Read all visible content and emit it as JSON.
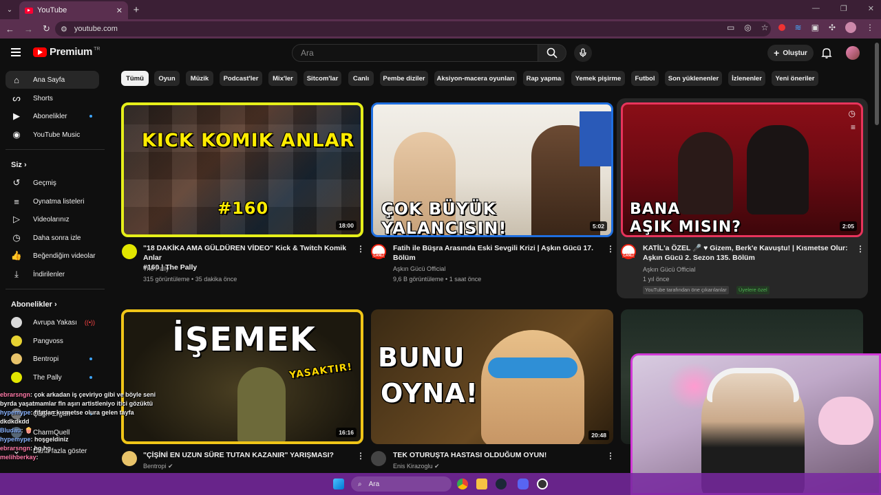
{
  "browser": {
    "tab_title": "YouTube",
    "url": "youtube.com"
  },
  "header": {
    "logo_text": "Premium",
    "logo_sup": "TR",
    "search_placeholder": "Ara",
    "create_label": "Oluştur"
  },
  "sidebar": {
    "main": [
      {
        "label": "Ana Sayfa",
        "icon": "home-icon"
      },
      {
        "label": "Shorts",
        "icon": "shorts-icon"
      },
      {
        "label": "Abonelikler",
        "icon": "subscriptions-icon"
      },
      {
        "label": "YouTube Music",
        "icon": "music-icon"
      }
    ],
    "you_title": "Siz",
    "you": [
      {
        "label": "Geçmiş",
        "icon": "history-icon"
      },
      {
        "label": "Oynatma listeleri",
        "icon": "playlists-icon"
      },
      {
        "label": "Videolarınız",
        "icon": "your-videos-icon"
      },
      {
        "label": "Daha sonra izle",
        "icon": "watch-later-icon"
      },
      {
        "label": "Beğendiğim videolar",
        "icon": "liked-icon"
      },
      {
        "label": "İndirilenler",
        "icon": "downloads-icon"
      }
    ],
    "subs_title": "Abonelikler",
    "subs": [
      {
        "label": "Avrupa Yakası",
        "color": "#d9d9d9"
      },
      {
        "label": "Pangvoss",
        "color": "#e6d232"
      },
      {
        "label": "Bentropi",
        "color": "#e8c36a"
      },
      {
        "label": "The Pally",
        "color": "#e2e600"
      },
      {
        "label": "Çağrı Ergün",
        "color": "#777777"
      },
      {
        "label": "CharmQuell",
        "color": "#556677"
      },
      {
        "label": "Daha fazla göster",
        "color": "#0f0f0f"
      }
    ]
  },
  "chips": [
    "Tümü",
    "Oyun",
    "Müzik",
    "Podcast'ler",
    "Mix'ler",
    "Sitcom'lar",
    "Canlı",
    "Pembe diziler",
    "Aksiyon-macera oyunları",
    "Rap yapma",
    "Yemek pişirme",
    "Futbol",
    "Son yüklenenler",
    "İzlenenler",
    "Yeni öneriler"
  ],
  "videos": [
    {
      "title_1": "\"18 DAKİKA AMA GÜLDÜREN VİDEO\" Kick & Twitch Komik Anlar",
      "title_2": "#160 | The Pally",
      "channel": "The Pally",
      "stats": "315 görüntüleme • 35 dakika önce",
      "duration": "18:00",
      "thumb_text_1": "KICK KOMIK ANLAR",
      "thumb_text_2": "#160"
    },
    {
      "title_1": "Fatih ile Büşra Arasında Eski Sevgili Krizi | Aşkın Gücü 17.",
      "title_2": "Bölüm",
      "channel": "Aşkın Gücü Official",
      "stats": "9,6 B görüntüleme • 1 saat önce",
      "duration": "5:02",
      "thumb_text_1": "ÇOK BÜYÜK",
      "thumb_text_2": "YALANCISIN!",
      "avatar_label": "CANLI"
    },
    {
      "title_1": "KATİL'a ÖZEL 🎤 ♥ Gizem, Berk'e Kavuştu! | Kısmetse Olur:",
      "title_2": "Aşkın Gücü 2. Sezon 135. Bölüm",
      "channel": "Aşkın Gücü Official",
      "stats": "1 yıl önce",
      "duration": "2:05",
      "thumb_text_1": "BANA",
      "thumb_text_2": "AŞIK MISIN?",
      "avatar_label": "CANLI",
      "badge_1": "YouTube tarafından öne çıkarılanlar",
      "badge_2": "Üyelere özel"
    },
    {
      "title_1": "\"ÇİŞİNİ EN UZUN SÜRE TUTAN KAZANIR\" YARIŞMASI?",
      "channel": "Bentropi",
      "duration": "16:16",
      "thumb_text_1": "İŞEMEK",
      "thumb_text_2": "YASAKTIR!"
    },
    {
      "title_1": "TEK OTURUŞTA HASTASI OLDUĞUM OYUN!",
      "channel": "Enis Kirazoglu",
      "duration": "20:48",
      "thumb_text_1": "BUNU",
      "thumb_text_2": "OYNA!"
    }
  ],
  "chat": [
    {
      "user": "ebrarsngn",
      "msg": ": çok arkadan iş çeviriyo gibi ve böyle seni byrda yaşatmamlar fln aşırı artistleniyo itici gözüktü"
    },
    {
      "user": "hypemype",
      "msg": ": fifadan kısmetse olura gelen tayfa dkdkdkdd"
    },
    {
      "user": "Bludau",
      "msg": ": 🍿"
    },
    {
      "user": "hypemype",
      "msg": ": hoşgeldiniz"
    },
    {
      "user": "ebrarsngn",
      "msg": ": hg hg"
    },
    {
      "user": "melihberkay",
      "msg": ":"
    }
  ],
  "taskbar": {
    "search_label": "Ara"
  }
}
